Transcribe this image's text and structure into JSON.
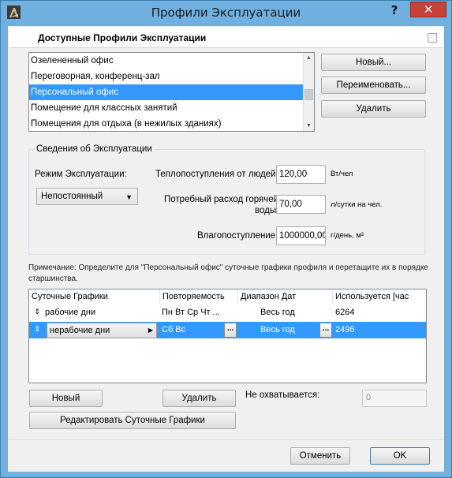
{
  "window": {
    "title": "Профили Эксплуатации",
    "help_label": "?",
    "close_label": "✕"
  },
  "header": {
    "title": "Доступные Профили Эксплуатации"
  },
  "profiles": {
    "items": [
      "Озелененный офис",
      "Переговорная, конференц-зал",
      "Персональный офис",
      "Помещение для классных занятий",
      "Помещения для отдыха (в нежилых зданиях)"
    ],
    "selected_index": 2
  },
  "profile_buttons": {
    "new": "Новый...",
    "rename": "Переименовать...",
    "delete": "Удалить"
  },
  "operation": {
    "legend": "Сведения об Эксплуатации",
    "mode_label": "Режим Эксплуатации:",
    "mode_value": "Непостоянный",
    "heat_label": "Теплопоступления от людей:",
    "heat_value": "120,00",
    "heat_unit": "Вт/чел",
    "water_label_1": "Потребный расход горячей",
    "water_label_2": "воды:",
    "water_value": "70,00",
    "water_unit": "л/сутки на чел.",
    "moisture_label": "Влагопоступление:",
    "moisture_value": "1000000,00",
    "moisture_unit": "г/день, м²"
  },
  "note": "Примечание: Определите для \"Персональный офис\" суточные графики профиля и перетащите их в порядке старшинства.",
  "schedules": {
    "columns": [
      "Суточные Графики",
      "Повторяемость",
      "Диапазон Дат",
      "Используется [час"
    ],
    "rows": [
      {
        "name": "рабочие дни",
        "repeat": "Пн Вт Ср Чт ...",
        "range": "Весь год",
        "used": "6264"
      },
      {
        "name": "нерабочие дни",
        "repeat": "Сб Вс",
        "range": "Весь год",
        "used": "2496"
      }
    ],
    "drag_glyph": "⇕",
    "ellipsis": "..."
  },
  "schedule_buttons": {
    "new": "Новый",
    "delete": "Удалить",
    "edit": "Редактировать Суточные Графики",
    "uncovered_label": "Не охватывается:",
    "uncovered_value": "0"
  },
  "footer": {
    "cancel": "Отменить",
    "ok": "OK"
  }
}
